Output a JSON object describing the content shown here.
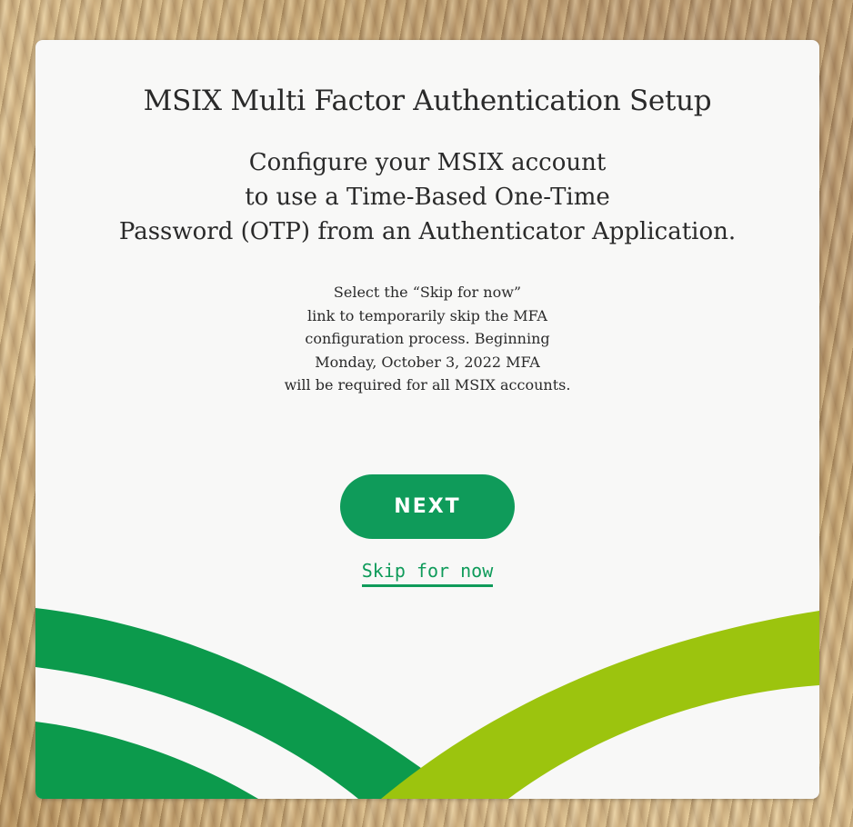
{
  "card": {
    "title": "MSIX Multi Factor Authentication Setup",
    "subtitle_lines": [
      "Configure your MSIX account",
      "to use a Time-Based One-Time",
      "Password (OTP) from an Authenticator Application."
    ],
    "notice_lines": [
      "Select the “Skip for now”",
      "link to temporarily skip the MFA",
      "configuration process. Beginning",
      "Monday, October 3, 2022 MFA",
      "will be required for all MSIX accounts."
    ],
    "next_label": "NEXT",
    "skip_label": "Skip for now"
  },
  "colors": {
    "accent_green": "#0f9b5a",
    "swoosh_dark_green": "#0c9a4c",
    "swoosh_lime": "#9cc40e",
    "card_bg": "#f8f8f7"
  },
  "icons": [
    "decorative-swoosh-graphic",
    "wheat-field-background"
  ]
}
